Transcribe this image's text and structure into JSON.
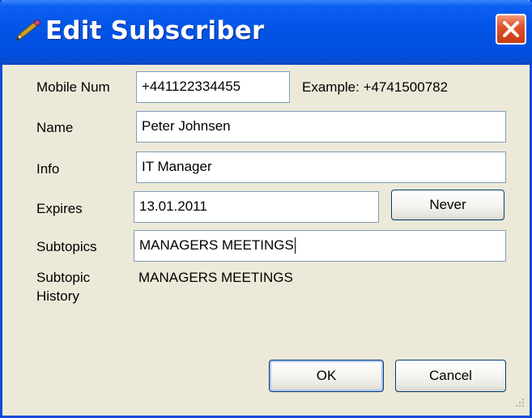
{
  "window": {
    "title": "Edit Subscriber"
  },
  "form": {
    "mobile_label": "Mobile Num",
    "mobile_value": "+441122334455",
    "mobile_example": "Example: +4741500782",
    "name_label": "Name",
    "name_value": "Peter Johnsen",
    "info_label": "Info",
    "info_value": "IT Manager",
    "expires_label": "Expires",
    "expires_value": "13.01.2011",
    "never_label": "Never",
    "subtopics_label": "Subtopics",
    "subtopics_value": "MANAGERS MEETINGS",
    "history_label_line1": "Subtopic",
    "history_label_line2": "History",
    "history_value": "MANAGERS MEETINGS"
  },
  "buttons": {
    "ok_label": "OK",
    "cancel_label": "Cancel"
  },
  "colors": {
    "titlebar": "#0254e6",
    "dialog_bg": "#ece9d8",
    "close_button": "#e2522c",
    "field_border": "#7f9db9"
  },
  "icons": {
    "title": "edit-pencil-icon",
    "close": "close-icon",
    "grip": "resize-grip-icon"
  }
}
